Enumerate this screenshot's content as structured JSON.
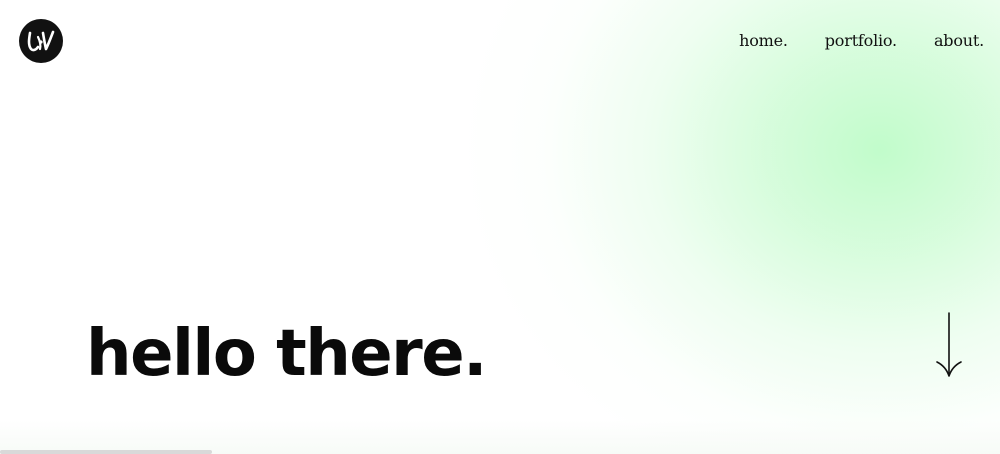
{
  "logo": {
    "icon": "lw-monogram-icon"
  },
  "nav": {
    "items": [
      {
        "label": "home."
      },
      {
        "label": "portfolio."
      },
      {
        "label": "about."
      }
    ]
  },
  "hero": {
    "title": "hello there."
  },
  "scroll_indicator": {
    "icon": "arrow-down-icon"
  },
  "colors": {
    "background": "#ffffff",
    "accent_glow": "#c6fccf",
    "text": "#111111"
  }
}
